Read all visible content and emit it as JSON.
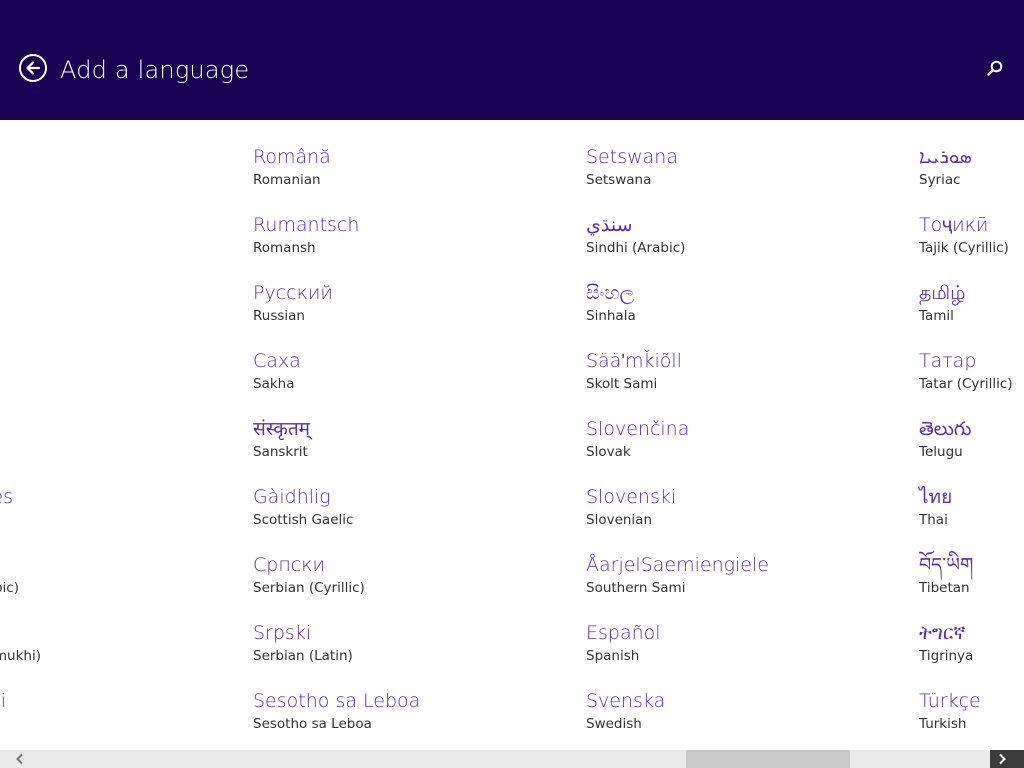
{
  "header": {
    "title": "Add a language",
    "back_icon": "back-arrow-icon",
    "search_icon": "search-icon"
  },
  "columns": [
    {
      "items": [
        {
          "native": "",
          "english": ""
        },
        {
          "native": "",
          "english": ""
        },
        {
          "native": "",
          "english": ""
        },
        {
          "native": "",
          "english": ""
        },
        {
          "native": "",
          "english": ""
        },
        {
          "native": "ês",
          "english": ""
        },
        {
          "native": "",
          "english": "bic)"
        },
        {
          "native": "",
          "english": "mukhi)"
        },
        {
          "native": "i",
          "english": ""
        }
      ]
    },
    {
      "items": [
        {
          "native": "Română",
          "english": "Romanian"
        },
        {
          "native": "Rumantsch",
          "english": "Romansh"
        },
        {
          "native": "Русский",
          "english": "Russian"
        },
        {
          "native": "Саха",
          "english": "Sakha"
        },
        {
          "native": "संस्कृतम्",
          "english": "Sanskrit"
        },
        {
          "native": "Gàidhlig",
          "english": "Scottish Gaelic"
        },
        {
          "native": "Српски",
          "english": "Serbian (Cyrillic)"
        },
        {
          "native": "Srpski",
          "english": "Serbian (Latin)"
        },
        {
          "native": "Sesotho sa Leboa",
          "english": "Sesotho sa Leboa"
        }
      ]
    },
    {
      "items": [
        {
          "native": "Setswana",
          "english": "Setswana"
        },
        {
          "native": "سنڌي",
          "english": "Sindhi (Arabic)"
        },
        {
          "native": "සිංහල",
          "english": "Sinhala"
        },
        {
          "native": "Sääʹmǩiõll",
          "english": "Skolt Sami"
        },
        {
          "native": "Slovenčina",
          "english": "Slovak"
        },
        {
          "native": "Slovenski",
          "english": "Slovenian"
        },
        {
          "native": "ÅarjelSaemiengiele",
          "english": "Southern Sami"
        },
        {
          "native": "Español",
          "english": "Spanish"
        },
        {
          "native": "Svenska",
          "english": "Swedish"
        }
      ]
    },
    {
      "items": [
        {
          "native": "ܣܘܪܝܝܐ",
          "english": "Syriac"
        },
        {
          "native": "Тоҷикӣ",
          "english": "Tajik (Cyrillic)"
        },
        {
          "native": "தமிழ்",
          "english": "Tamil"
        },
        {
          "native": "Татар",
          "english": "Tatar (Cyrillic)"
        },
        {
          "native": "తెలుగు",
          "english": "Telugu"
        },
        {
          "native": "ไทย",
          "english": "Thai"
        },
        {
          "native": "བོད་ཡིག",
          "english": "Tibetan"
        },
        {
          "native": "ትግርኛ",
          "english": "Tigrinya"
        },
        {
          "native": "Türkçe",
          "english": "Turkish"
        }
      ]
    }
  ],
  "scrollbar": {
    "left_icon": "chevron-left-icon",
    "right_icon": "chevron-right-icon",
    "position": 0.81
  },
  "colors": {
    "header_bg": "#180052",
    "accent": "#5b2ea6",
    "text": "#333333"
  }
}
